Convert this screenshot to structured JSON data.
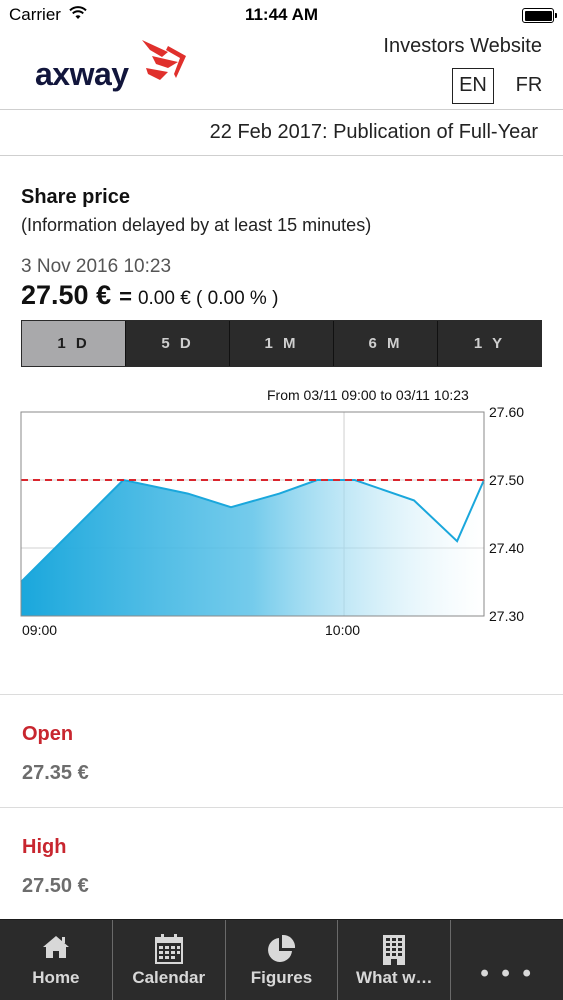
{
  "status_bar": {
    "carrier": "Carrier",
    "time": "11:44 AM"
  },
  "header": {
    "logo_text": "axway",
    "site_title": "Investors Website",
    "languages": [
      "EN",
      "FR"
    ],
    "active_language": "EN"
  },
  "ticker": {
    "text": "22 Feb 2017: Publication of Full-Year"
  },
  "share": {
    "title": "Share price",
    "subtitle": "(Information delayed by at least 15 minutes)",
    "date": "3 Nov 2016 10:23",
    "price": "27.50 €",
    "equals_sign": "=",
    "change": "0.00 € ( 0.00 % )"
  },
  "periods": {
    "items": [
      "1 D",
      "5 D",
      "1 M",
      "6 M",
      "1 Y"
    ],
    "active": "1 D"
  },
  "colors": {
    "accent_red": "#c8262f",
    "chart_blue": "#1aa7dc",
    "reference_line": "#d9262d",
    "tab_bar": "#2b2b2b"
  },
  "chart_data": {
    "type": "area",
    "range_label": "From 03/11 09:00 to 03/11 10:23",
    "x_tick_labels": [
      "09:00",
      "10:00"
    ],
    "y_tick_labels": [
      "27.60",
      "27.50",
      "27.40",
      "27.30"
    ],
    "ylim": [
      27.3,
      27.6
    ],
    "x_range_minutes": [
      0,
      86
    ],
    "grid": true,
    "reference_line": {
      "value": 27.5,
      "style": "dashed"
    },
    "series": [
      {
        "x": [
          0,
          19,
          31,
          39,
          48,
          55,
          62,
          73,
          81,
          86
        ],
        "y": [
          27.35,
          27.5,
          27.48,
          27.46,
          27.48,
          27.5,
          27.5,
          27.47,
          27.41,
          27.5
        ]
      }
    ]
  },
  "stats": [
    {
      "label": "Open",
      "value": "27.35 €"
    },
    {
      "label": "High",
      "value": "27.50 €"
    }
  ],
  "tabbar": {
    "items": [
      {
        "label": "Home",
        "icon": "home-icon"
      },
      {
        "label": "Calendar",
        "icon": "calendar-icon"
      },
      {
        "label": "Figures",
        "icon": "pie-chart-icon"
      },
      {
        "label": "What w…",
        "icon": "building-icon"
      },
      {
        "label": "",
        "icon": "more-icon",
        "glyph": "• • •"
      }
    ]
  }
}
